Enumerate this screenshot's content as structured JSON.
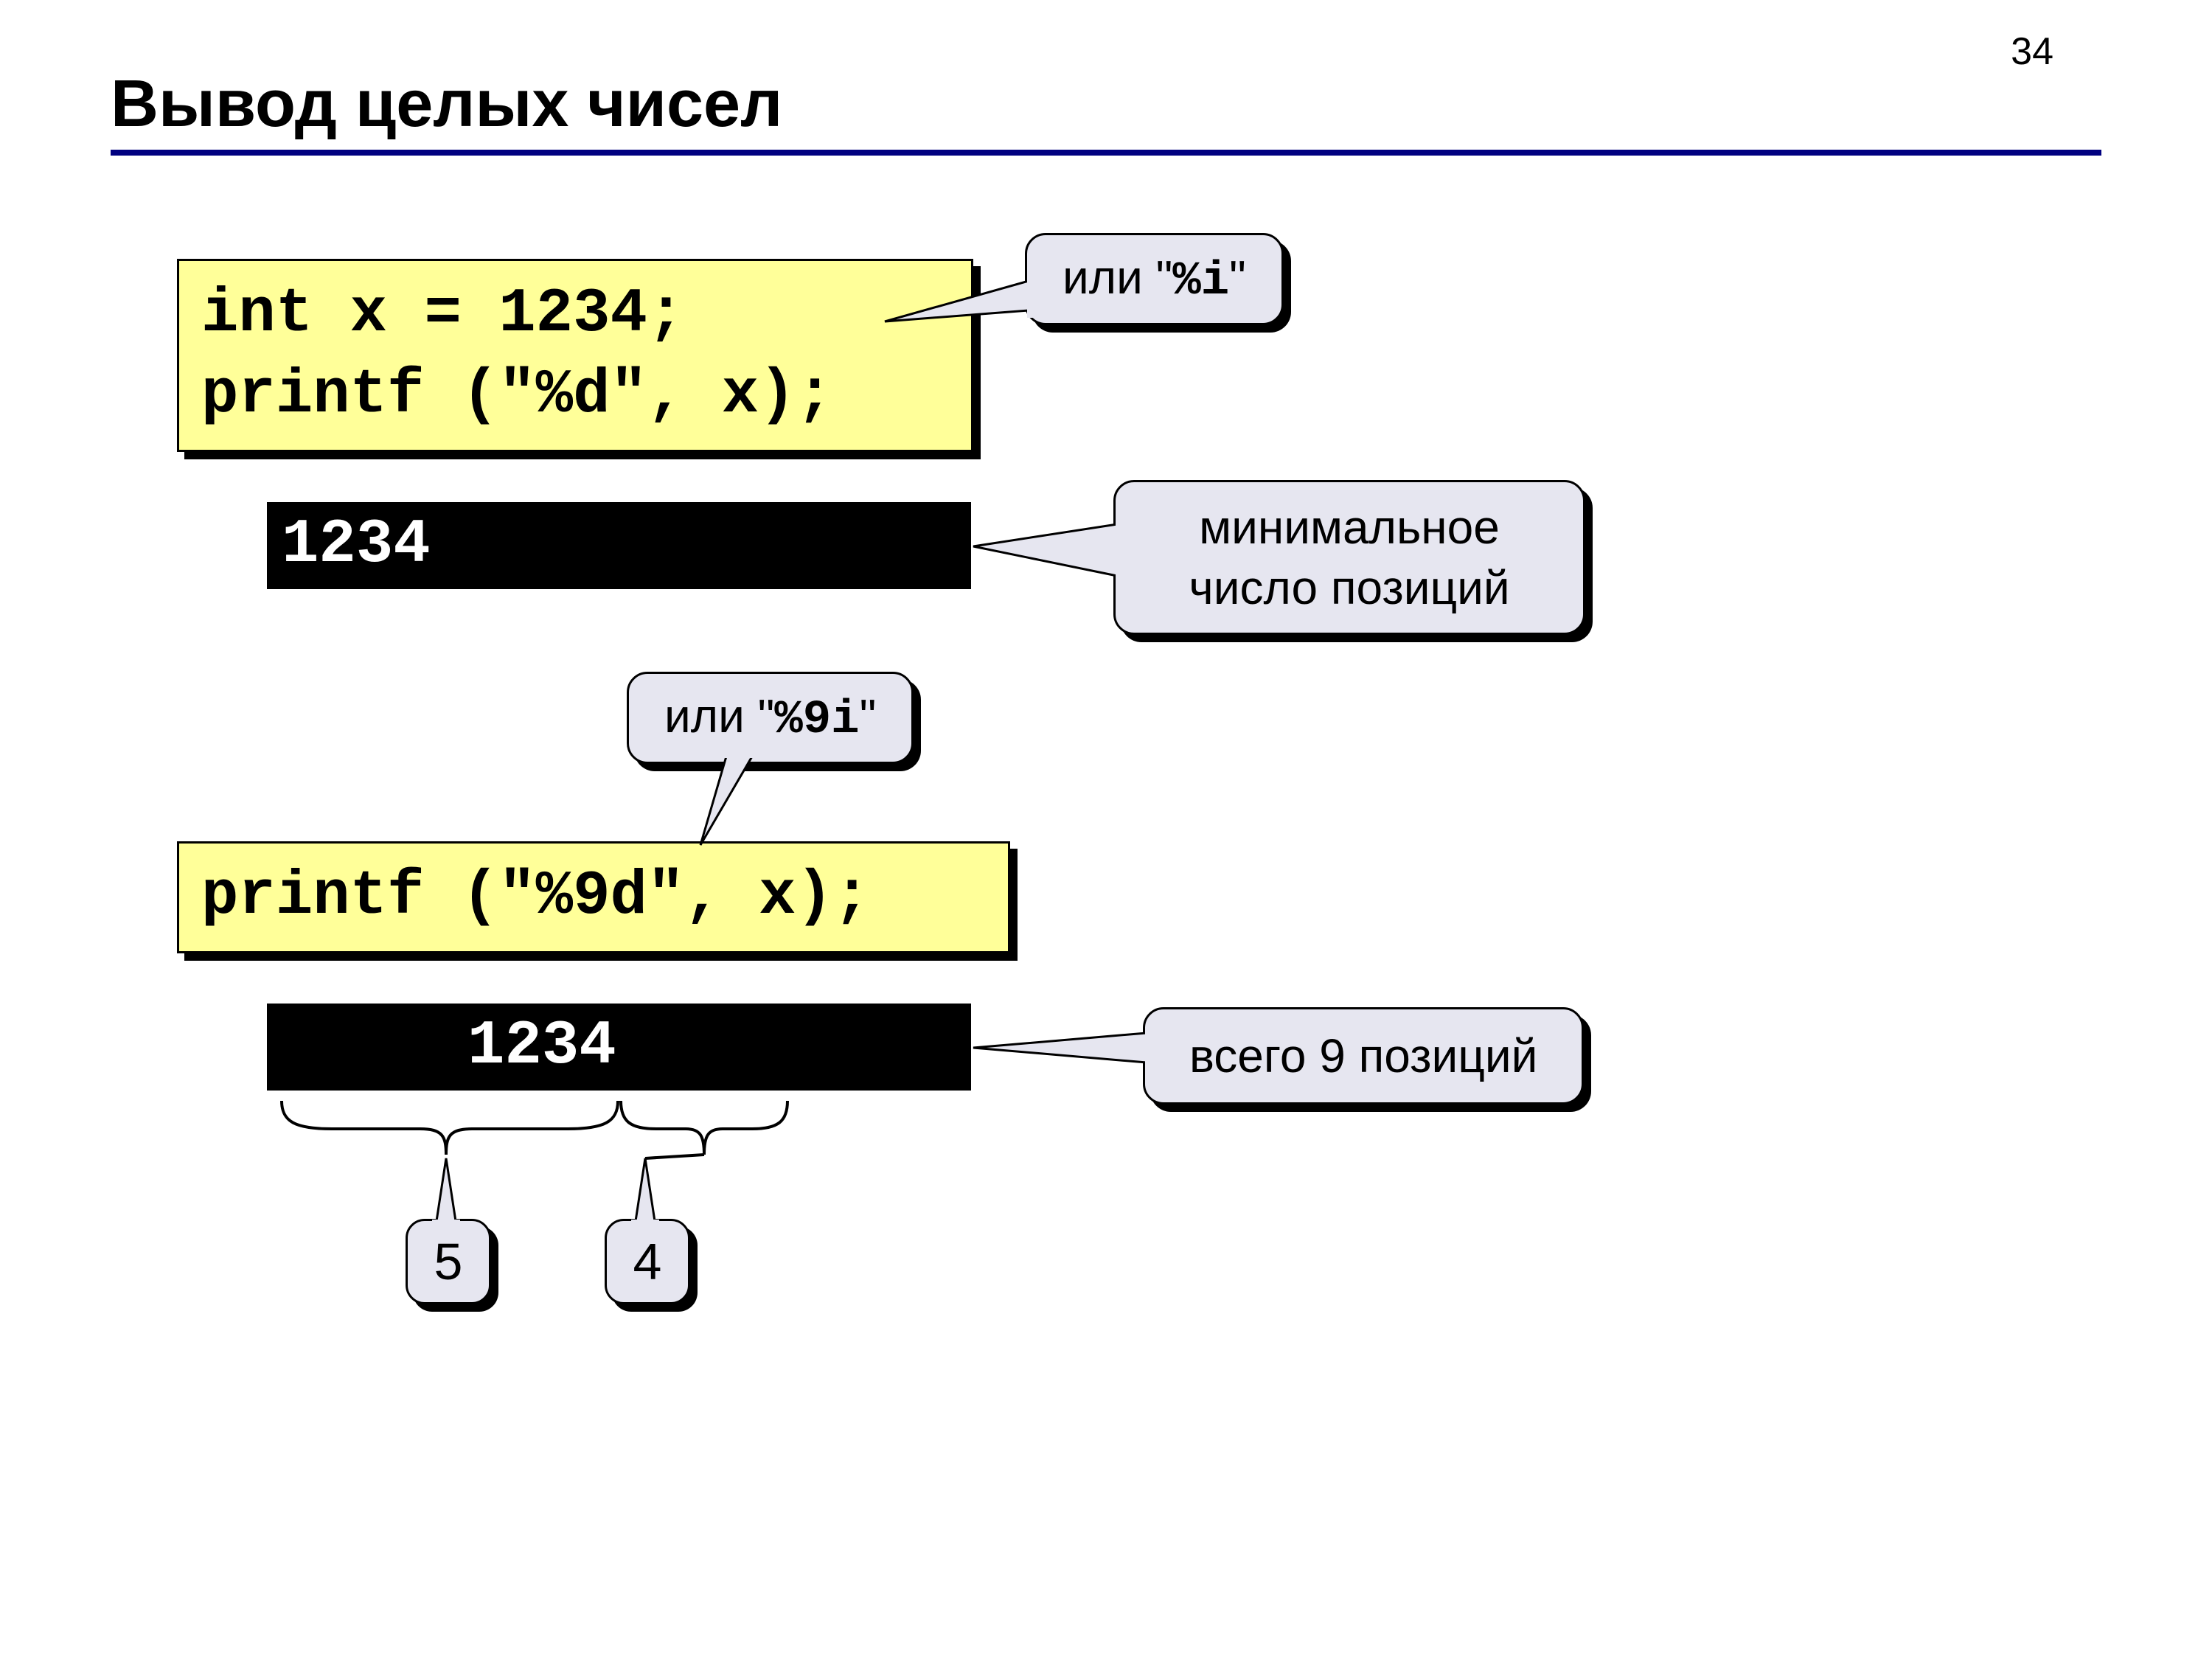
{
  "page_number": "34",
  "title": "Вывод целых чисел",
  "code1_line1": "int x = 1234;",
  "code1_line2": "printf (\"%d\", x);",
  "callout_i_prefix": "или \"",
  "callout_i_code": "%i",
  "callout_i_suffix": "\"",
  "output1": "1234",
  "callout_min_line1": "минимальное",
  "callout_min_line2": "число позиций",
  "callout_9i_prefix": "или \"",
  "callout_9i_code": "%9i",
  "callout_9i_suffix": "\"",
  "code2": "printf (\"%9d\", x);",
  "output2": "     1234",
  "callout_total": "всего 9 позиций",
  "brace_left": "5",
  "brace_right": "4"
}
